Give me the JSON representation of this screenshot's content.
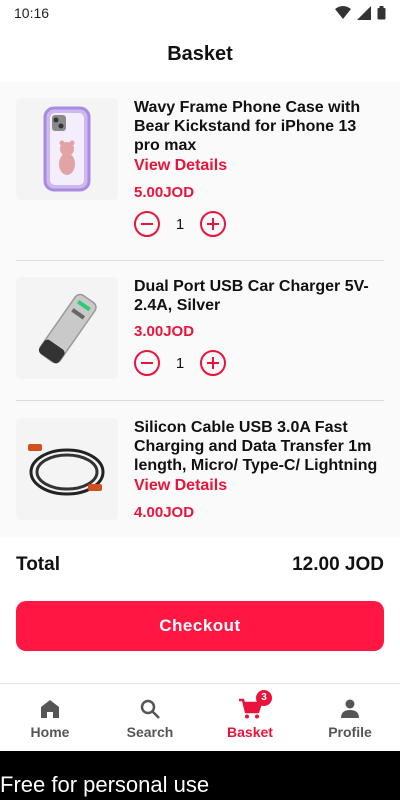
{
  "status": {
    "time": "10:16"
  },
  "header": {
    "title": "Basket"
  },
  "items": [
    {
      "title": "Wavy Frame Phone Case with Bear Kickstand for iPhone 13 pro max",
      "details": "View Details",
      "price": "5.00JOD",
      "qty": "1"
    },
    {
      "title": "Dual Port USB Car Charger 5V-2.4A, Silver",
      "price": "3.00JOD",
      "qty": "1"
    },
    {
      "title": "Silicon Cable USB 3.0A Fast Charging and Data Transfer 1m length, Micro/ Type-C/ Lightning",
      "details": "View Details",
      "price": "4.00JOD"
    }
  ],
  "total": {
    "label": "Total",
    "value": "12.00 JOD"
  },
  "checkout": {
    "label": "Checkout"
  },
  "nav": [
    {
      "label": "Home",
      "icon": "home-icon"
    },
    {
      "label": "Search",
      "icon": "search-icon"
    },
    {
      "label": "Basket",
      "icon": "cart-icon",
      "badge": "3"
    },
    {
      "label": "Profile",
      "icon": "profile-icon"
    }
  ],
  "footer": {
    "text": "Free for personal use"
  },
  "colors": {
    "accent": "#e8143c",
    "button": "#ff1744"
  }
}
